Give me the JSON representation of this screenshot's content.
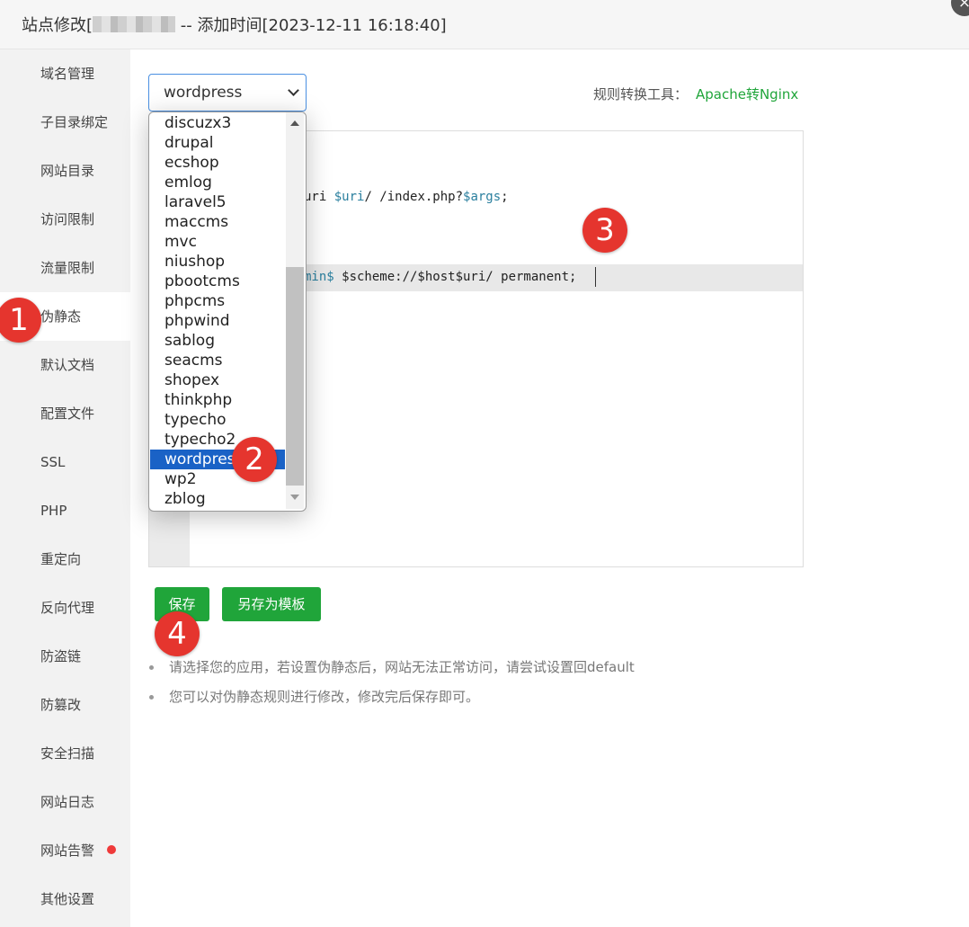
{
  "header": {
    "title_prefix": "站点修改[",
    "title_suffix": " -- 添加时间[2023-12-11 16:18:40]",
    "close_icon": "×"
  },
  "sidebar": {
    "items": [
      {
        "label": "域名管理"
      },
      {
        "label": "子目录绑定"
      },
      {
        "label": "网站目录"
      },
      {
        "label": "访问限制"
      },
      {
        "label": "流量限制"
      },
      {
        "label": "伪静态",
        "active": true
      },
      {
        "label": "默认文档"
      },
      {
        "label": "配置文件"
      },
      {
        "label": "SSL"
      },
      {
        "label": "PHP"
      },
      {
        "label": "重定向"
      },
      {
        "label": "反向代理"
      },
      {
        "label": "防盗链"
      },
      {
        "label": "防篡改"
      },
      {
        "label": "安全扫描"
      },
      {
        "label": "网站日志"
      },
      {
        "label": "网站告警",
        "alert": true
      },
      {
        "label": "其他设置"
      }
    ]
  },
  "rewrite": {
    "selected": "wordpress",
    "tool_label": "规则转换工具：",
    "tool_link": "Apache转Nginx",
    "options": [
      "discuzx3",
      "drupal",
      "ecshop",
      "emlog",
      "laravel5",
      "maccms",
      "mvc",
      "niushop",
      "pbootcms",
      "phpcms",
      "phpwind",
      "sablog",
      "seacms",
      "shopex",
      "thinkphp",
      "typecho",
      "typecho2",
      "wordpress",
      "wp2",
      "zblog"
    ]
  },
  "editor": {
    "line1_pre": "uri ",
    "line1_var1": "$uri",
    "line1_mid": "/ /index.php?",
    "line1_var2": "$args",
    "line1_end": ";",
    "line2_pre": "min$",
    "line2_rest": " $scheme://$host$uri/ permanent;"
  },
  "buttons": {
    "save": "保存",
    "save_template": "另存为模板"
  },
  "tips": [
    "请选择您的应用，若设置伪静态后，网站无法正常访问，请尝试设置回default",
    "您可以对伪静态规则进行修改，修改完后保存即可。"
  ],
  "markers": [
    "1",
    "2",
    "3",
    "4"
  ],
  "colors": {
    "accent": "#20a53a",
    "selection": "#1a62c6",
    "marker": "#e5352e",
    "alert": "#ef3a3a"
  }
}
